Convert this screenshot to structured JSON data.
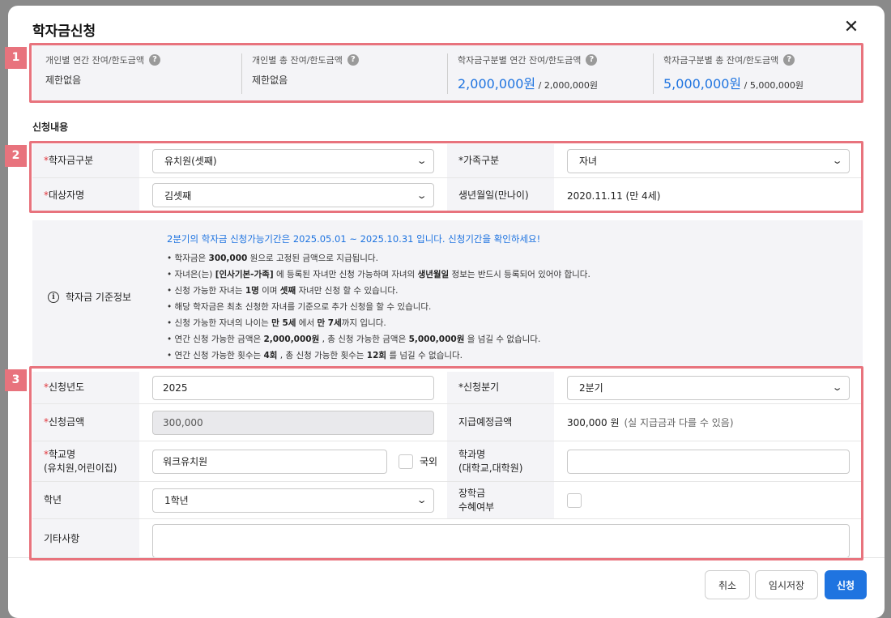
{
  "dialog": {
    "title": "학자금신청",
    "close_icon": "close-icon"
  },
  "markers": [
    "1",
    "2",
    "3"
  ],
  "summary": [
    {
      "label": "개인별 연간 잔여/한도금액",
      "value": "제한없음"
    },
    {
      "label": "개인별 총 잔여/한도금액",
      "value": "제한없음"
    },
    {
      "label": "학자금구분별 연간 잔여/한도금액",
      "amount": "2,000,000원",
      "limit": " / 2,000,000원"
    },
    {
      "label": "학자금구분별 총 잔여/한도금액",
      "amount": "5,000,000원",
      "limit": " / 5,000,000원"
    }
  ],
  "section_title": "신청내용",
  "form": {
    "type_label": "학자금구분",
    "type_value": "유치원(셋째)",
    "family_label": "가족구분",
    "family_value": "자녀",
    "target_label": "대상자명",
    "target_value": "김셋째",
    "birth_label": "생년월일(만나이)",
    "birth_value": "2020.11.11 (만 4세)"
  },
  "info": {
    "label": "학자금 기준정보",
    "head": "2분기의 학자금 신청가능기간은 2025.05.01 ~ 2025.10.31 입니다. 신청기간을 확인하세요!",
    "lines": [
      [
        "• 학자금은 ",
        "300,000",
        " 원으로 고정된 금액으로 지급됩니다."
      ],
      [
        "• 자녀은(는) ",
        "[인사기본-가족]",
        " 에 등록된 자녀만 신청 가능하며 자녀의 ",
        "생년월일",
        " 정보는 반드시 등록되어 있어야 합니다."
      ],
      [
        "• 신청 가능한 자녀는 ",
        "1명",
        " 이며 ",
        "셋째",
        " 자녀만 신청 할 수 있습니다."
      ],
      [
        "• 해당 학자금은 최초 신청한 자녀를 기준으로 추가 신청을 할 수 있습니다."
      ],
      [
        "• 신청 가능한 자녀의 나이는 ",
        "만 5세",
        " 에서 ",
        "만 7세",
        "까지 입니다."
      ],
      [
        "• 연간 신청 가능한 금액은 ",
        "2,000,000원",
        " , 총 신청 가능한 금액은 ",
        "5,000,000원",
        " 을 넘길 수 없습니다."
      ],
      [
        "• 연간 신청 가능한 횟수는 ",
        "4회",
        " , 총 신청 가능한 횟수는 ",
        "12회",
        " 를 넘길 수 없습니다."
      ]
    ]
  },
  "apply": {
    "year_label": "신청년도",
    "year_value": "2025",
    "quarter_label": "신청분기",
    "quarter_value": "2분기",
    "amount_label": "신청금액",
    "amount_value": "300,000",
    "expected_label": "지급예정금액",
    "expected_value": "300,000 원",
    "expected_note": "(실 지급금과 다를 수 있음)",
    "school_label_1": "학교명",
    "school_label_2": "(유치원,어린이집)",
    "school_value": "워크유치원",
    "overseas_label": "국외",
    "dept_label_1": "학과명",
    "dept_label_2": "(대학교,대학원)",
    "dept_value": "",
    "grade_label": "학년",
    "grade_value": "1학년",
    "scholar_label_1": "장학금",
    "scholar_label_2": "수혜여부",
    "etc_label": "기타사항"
  },
  "buttons": {
    "cancel": "취소",
    "temp_save": "임시저장",
    "submit": "신청"
  },
  "colors": {
    "accent": "#1f74e0",
    "highlight": "#e8737d",
    "required": "#e0363c"
  }
}
